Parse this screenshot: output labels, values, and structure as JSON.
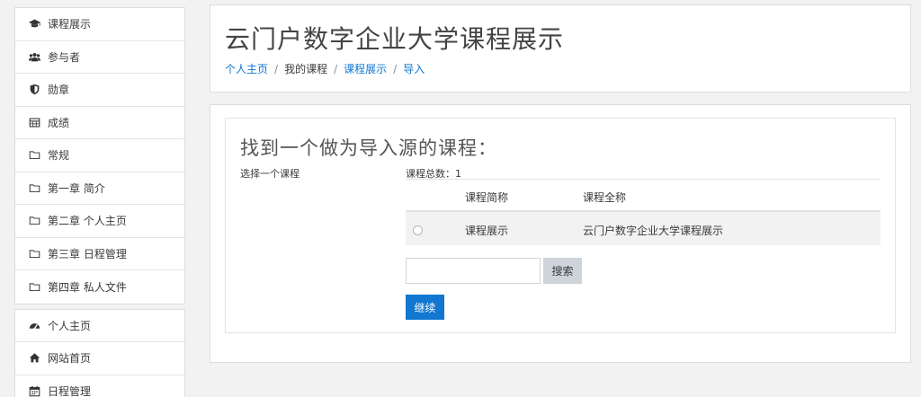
{
  "sidebar": {
    "group1": [
      {
        "label": "课程展示",
        "icon": "graduation-cap-icon"
      },
      {
        "label": "参与者",
        "icon": "users-icon"
      },
      {
        "label": "勋章",
        "icon": "shield-icon"
      },
      {
        "label": "成绩",
        "icon": "table-icon"
      },
      {
        "label": "常规",
        "icon": "folder-icon"
      },
      {
        "label": "第一章 简介",
        "icon": "folder-icon"
      },
      {
        "label": "第二章 个人主页",
        "icon": "folder-icon"
      },
      {
        "label": "第三章 日程管理",
        "icon": "folder-icon"
      },
      {
        "label": "第四章 私人文件",
        "icon": "folder-icon"
      }
    ],
    "group2": [
      {
        "label": "个人主页",
        "icon": "dashboard-icon"
      },
      {
        "label": "网站首页",
        "icon": "home-icon"
      },
      {
        "label": "日程管理",
        "icon": "calendar-icon"
      }
    ]
  },
  "header": {
    "title": "云门户数字企业大学课程展示",
    "breadcrumb": [
      {
        "label": "个人主页",
        "link": true
      },
      {
        "label": "我的课程",
        "link": false
      },
      {
        "label": "课程展示",
        "link": true
      },
      {
        "label": "导入",
        "link": true
      }
    ],
    "separator": "/"
  },
  "main": {
    "section_title": "找到一个做为导入源的课程：",
    "select_label": "选择一个课程",
    "total_count": "课程总数：1",
    "columns": {
      "short_name": "课程简称",
      "full_name": "课程全称"
    },
    "rows": [
      {
        "short_name": "课程展示",
        "full_name": "云门户数字企业大学课程展示",
        "selected": false
      }
    ],
    "search": {
      "value": "",
      "placeholder": "",
      "button_label": "搜索"
    },
    "continue_label": "继续"
  },
  "colors": {
    "link": "#1177d1",
    "primary_button": "#1177d1",
    "secondary_button": "#ced4da",
    "row_highlight": "#f2f2f2"
  }
}
